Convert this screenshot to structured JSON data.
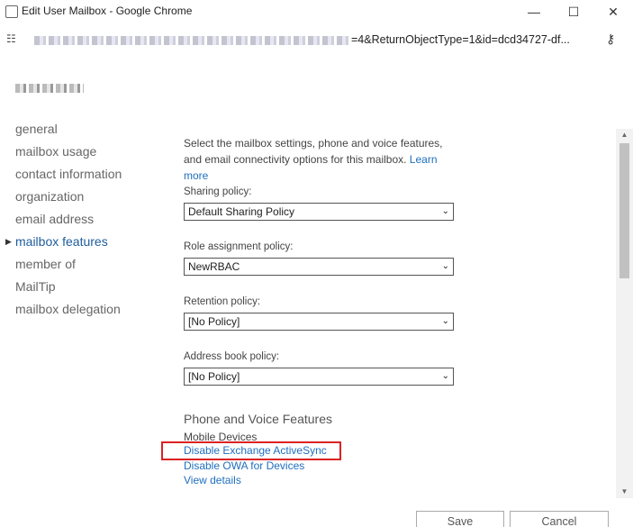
{
  "window": {
    "title": "Edit User Mailbox - Google Chrome",
    "minimize_glyph": "—",
    "maximize_glyph": "☐",
    "close_glyph": "✕"
  },
  "address_bar": {
    "url_visible": "=4&ReturnObjectType=1&id=dcd34727-df...",
    "site_info_icon": "tune-icon",
    "key_icon": "key-icon"
  },
  "nav": {
    "items": [
      {
        "label": "general"
      },
      {
        "label": "mailbox usage"
      },
      {
        "label": "contact information"
      },
      {
        "label": "organization"
      },
      {
        "label": "email address"
      },
      {
        "label": "mailbox features",
        "active": true
      },
      {
        "label": "member of"
      },
      {
        "label": "MailTip"
      },
      {
        "label": "mailbox delegation"
      }
    ]
  },
  "main": {
    "intro": "Select the mailbox settings, phone and voice features, and email connectivity options for this mailbox.",
    "learn_more": "Learn more",
    "sharing_policy": {
      "label": "Sharing policy:",
      "value": "Default Sharing Policy"
    },
    "role_assignment_policy": {
      "label": "Role assignment policy:",
      "value": "NewRBAC"
    },
    "retention_policy": {
      "label": "Retention policy:",
      "value": "[No Policy]"
    },
    "address_book_policy": {
      "label": "Address book policy:",
      "value": "[No Policy]"
    },
    "phone_voice_title": "Phone and Voice Features",
    "mobile_devices_label": "Mobile Devices",
    "disable_activesync": "Disable Exchange ActiveSync",
    "disable_owa": "Disable OWA for Devices",
    "view_details": "View details"
  },
  "footer": {
    "save": "Save",
    "cancel": "Cancel"
  },
  "colors": {
    "accent_link": "#1f6fbf",
    "highlight_border": "#dd2222"
  }
}
